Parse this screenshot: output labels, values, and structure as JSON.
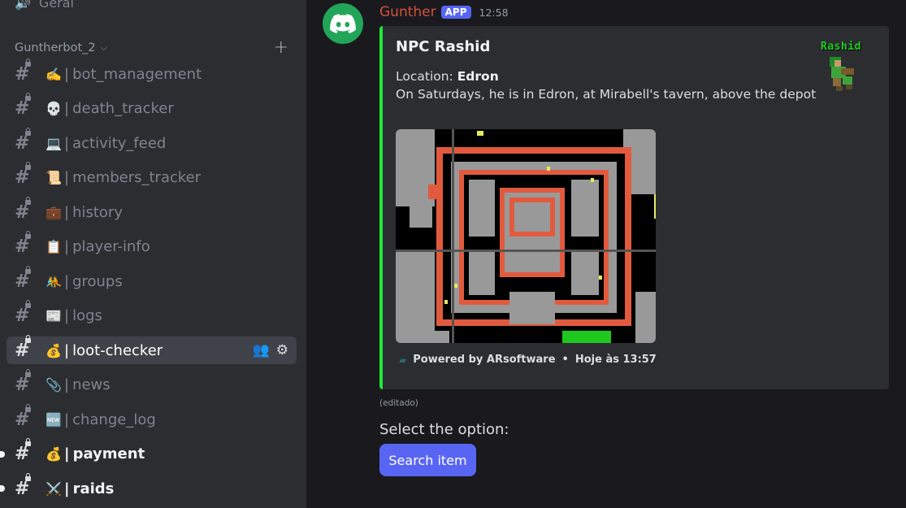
{
  "sidebar": {
    "previous_channel": {
      "icon": "speaker-icon",
      "label": "Geral"
    },
    "category": {
      "name": "Guntherbot_2",
      "chevron_icon": "chevron-down-icon",
      "add_icon": "plus-icon"
    },
    "channels": [
      {
        "emoji": "✍️",
        "name": "bot_management"
      },
      {
        "emoji": "💀",
        "name": "death_tracker"
      },
      {
        "emoji": "💻",
        "name": "activity_feed"
      },
      {
        "emoji": "📜",
        "name": "members_tracker"
      },
      {
        "emoji": "💼",
        "name": "history"
      },
      {
        "emoji": "📋",
        "name": "player-info"
      },
      {
        "emoji": "🤼",
        "name": "groups"
      },
      {
        "emoji": "📰",
        "name": "logs"
      },
      {
        "emoji": "💰",
        "name": "loot-checker",
        "state": "active"
      },
      {
        "emoji": "📎",
        "name": "news"
      },
      {
        "emoji": "🆕",
        "name": "change_log"
      },
      {
        "emoji": "💰",
        "name": "payment",
        "state": "unread"
      },
      {
        "emoji": "⚔️",
        "name": "raids",
        "state": "unread"
      }
    ],
    "separator": "|"
  },
  "message": {
    "author": "Gunther",
    "badge": "APP",
    "time": "12:58",
    "author_color": "#d2513c",
    "embed": {
      "accent_color": "#1eea3a",
      "title": "NPC Rashid",
      "location_label": "Location: ",
      "location_value": "Edron",
      "description": "On Saturdays, he is in Edron, at Mirabell's tavern, above the depot",
      "thumbnail_name": "Rashid",
      "footer_text": "Powered by ARsoftware",
      "footer_dot": "•",
      "footer_time": "Hoje às 13:57"
    },
    "edited": "(editado)",
    "prompt": "Select the option:",
    "button_label": "Search item"
  },
  "colors": {
    "button": "#5865f2",
    "avatar": "#23a559",
    "sidebar_bg": "#2b2d31",
    "main_bg": "#1a1a1e"
  }
}
